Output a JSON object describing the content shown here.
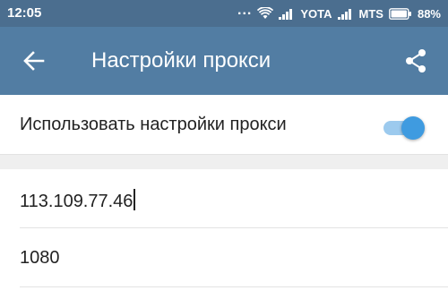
{
  "status_bar": {
    "time": "12:05",
    "dots": "...",
    "carrier1": "YOTA",
    "carrier2": "MTS",
    "battery": "88%"
  },
  "toolbar": {
    "title": "Настройки прокси",
    "back_icon": "arrow-left-icon",
    "share_icon": "share-icon"
  },
  "proxy_toggle": {
    "label": "Использовать настройки прокси",
    "enabled": true
  },
  "fields": {
    "server": "113.109.77.46",
    "port": "1080"
  },
  "colors": {
    "status_bar": "#4b6e8f",
    "toolbar": "#527da3",
    "switch_thumb": "#3f9be0",
    "switch_track": "#9ccaee"
  }
}
